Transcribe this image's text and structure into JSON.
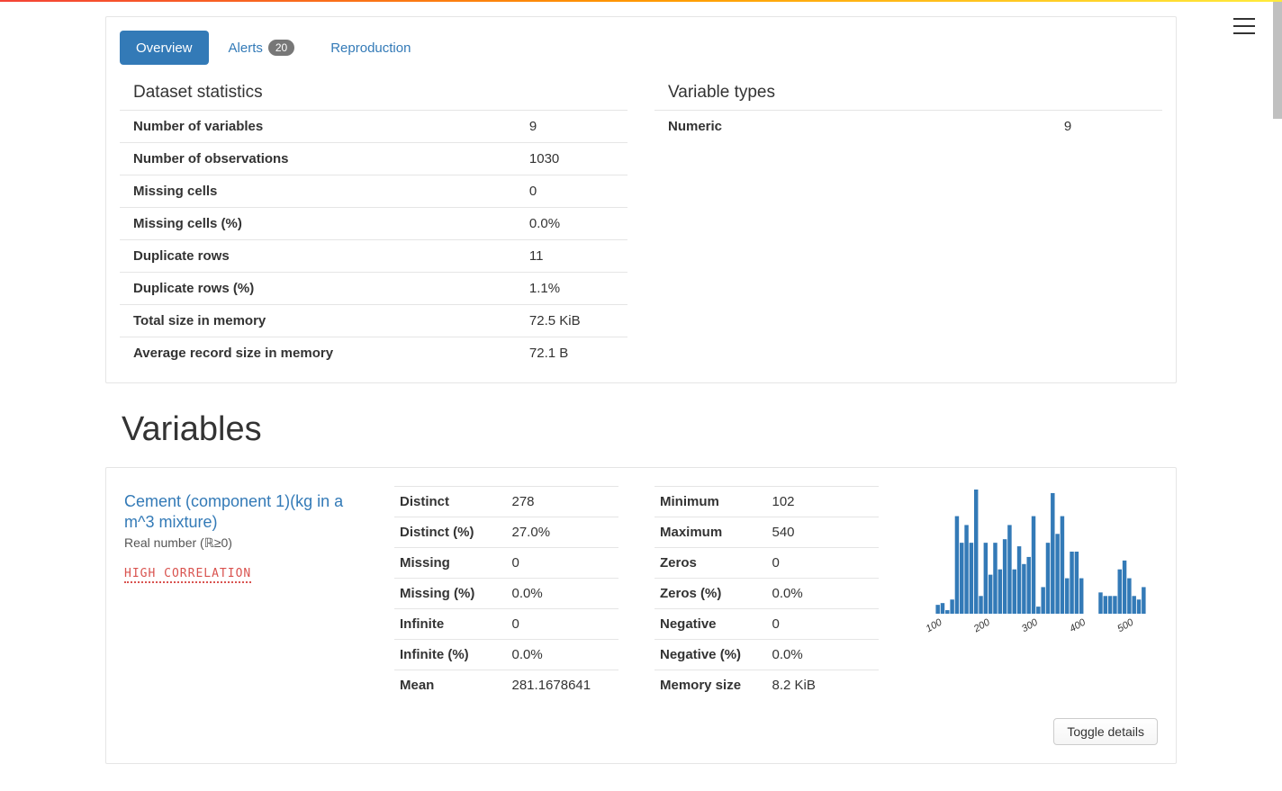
{
  "tabs": {
    "overview": "Overview",
    "alerts": "Alerts",
    "alerts_count": "20",
    "reproduction": "Reproduction"
  },
  "dataset_stats": {
    "title": "Dataset statistics",
    "rows": [
      {
        "label": "Number of variables",
        "value": "9"
      },
      {
        "label": "Number of observations",
        "value": "1030"
      },
      {
        "label": "Missing cells",
        "value": "0"
      },
      {
        "label": "Missing cells (%)",
        "value": "0.0%"
      },
      {
        "label": "Duplicate rows",
        "value": "11"
      },
      {
        "label": "Duplicate rows (%)",
        "value": "1.1%"
      },
      {
        "label": "Total size in memory",
        "value": "72.5 KiB"
      },
      {
        "label": "Average record size in memory",
        "value": "72.1 B"
      }
    ]
  },
  "variable_types": {
    "title": "Variable types",
    "rows": [
      {
        "label": "Numeric",
        "value": "9"
      }
    ]
  },
  "variables_heading": "Variables",
  "variable": {
    "name": "Cement (component 1)(kg in a m^3 mixture)",
    "subtitle": "Real number (ℝ≥0)",
    "warning": "HIGH CORRELATION",
    "stats1": [
      {
        "label": "Distinct",
        "value": "278"
      },
      {
        "label": "Distinct (%)",
        "value": "27.0%"
      },
      {
        "label": "Missing",
        "value": "0"
      },
      {
        "label": "Missing (%)",
        "value": "0.0%"
      },
      {
        "label": "Infinite",
        "value": "0"
      },
      {
        "label": "Infinite (%)",
        "value": "0.0%"
      },
      {
        "label": "Mean",
        "value": "281.1678641"
      }
    ],
    "stats2": [
      {
        "label": "Minimum",
        "value": "102"
      },
      {
        "label": "Maximum",
        "value": "540"
      },
      {
        "label": "Zeros",
        "value": "0"
      },
      {
        "label": "Zeros (%)",
        "value": "0.0%"
      },
      {
        "label": "Negative",
        "value": "0"
      },
      {
        "label": "Negative (%)",
        "value": "0.0%"
      },
      {
        "label": "Memory size",
        "value": "8.2 KiB"
      }
    ],
    "toggle_label": "Toggle details"
  },
  "chart_data": {
    "type": "bar",
    "xlabel": "",
    "ylabel": "",
    "xlim": [
      100,
      540
    ],
    "ylim": [
      0,
      70
    ],
    "xticks": [
      100,
      200,
      300,
      400,
      500
    ],
    "bin_starts": [
      100,
      110,
      120,
      130,
      140,
      150,
      160,
      170,
      180,
      190,
      200,
      210,
      220,
      230,
      240,
      250,
      260,
      270,
      280,
      290,
      300,
      310,
      320,
      330,
      340,
      350,
      360,
      370,
      380,
      390,
      400,
      410,
      420,
      430,
      440,
      450,
      460,
      470,
      480,
      490,
      500,
      510,
      520,
      530
    ],
    "values": [
      5,
      6,
      2,
      8,
      55,
      40,
      50,
      40,
      70,
      10,
      40,
      22,
      40,
      25,
      42,
      50,
      25,
      38,
      28,
      32,
      55,
      4,
      15,
      40,
      68,
      45,
      55,
      20,
      35,
      35,
      20,
      0,
      0,
      0,
      12,
      10,
      10,
      10,
      25,
      30,
      20,
      10,
      8,
      15
    ]
  }
}
